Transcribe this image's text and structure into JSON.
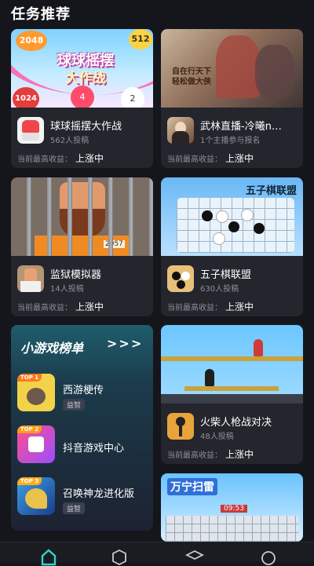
{
  "header": {
    "title": "任务推荐"
  },
  "earn_label": "当前最高收益：",
  "cards": [
    {
      "name": "球球摇摆大作战",
      "count": "562人投稿",
      "earn": "上涨中",
      "banner": {
        "logo": "球球摇摆",
        "logo2": "大作战",
        "n1": "2048",
        "n2": "512",
        "n3": "1024",
        "n4": "4",
        "n5": "2"
      }
    },
    {
      "name": "武林直播-冷曦n…",
      "count": "1个主播参与报名",
      "earn": "上涨中",
      "banner": {
        "text1": "自在行天下",
        "text2": "轻松做大侠"
      }
    },
    {
      "name": "监狱模拟器",
      "count": "14人投稿",
      "earn": "上涨中",
      "banner": {
        "sign": "2057"
      }
    },
    {
      "name": "五子棋联盟",
      "count": "630人投稿",
      "earn": "上涨中",
      "banner": {
        "title": "五子棋联盟"
      }
    },
    {
      "name": "火柴人枪战对决",
      "count": "48人投稿",
      "earn": "上涨中"
    },
    {
      "banner": {
        "title": "万宁扫雷",
        "timer": "09:53"
      }
    }
  ],
  "ranking": {
    "title": "小游戏榜单",
    "arrows": ">>>",
    "items": [
      {
        "rank": "TOP 1",
        "name": "西游梗传",
        "tag": "益智"
      },
      {
        "rank": "TOP 2",
        "name": "抖音游戏中心"
      },
      {
        "rank": "TOP 3",
        "name": "召唤神龙进化版",
        "tag": "益智"
      }
    ]
  },
  "colors": {
    "accent": "#2fd5c8",
    "bg": "#15161c",
    "card": "#24252d"
  }
}
